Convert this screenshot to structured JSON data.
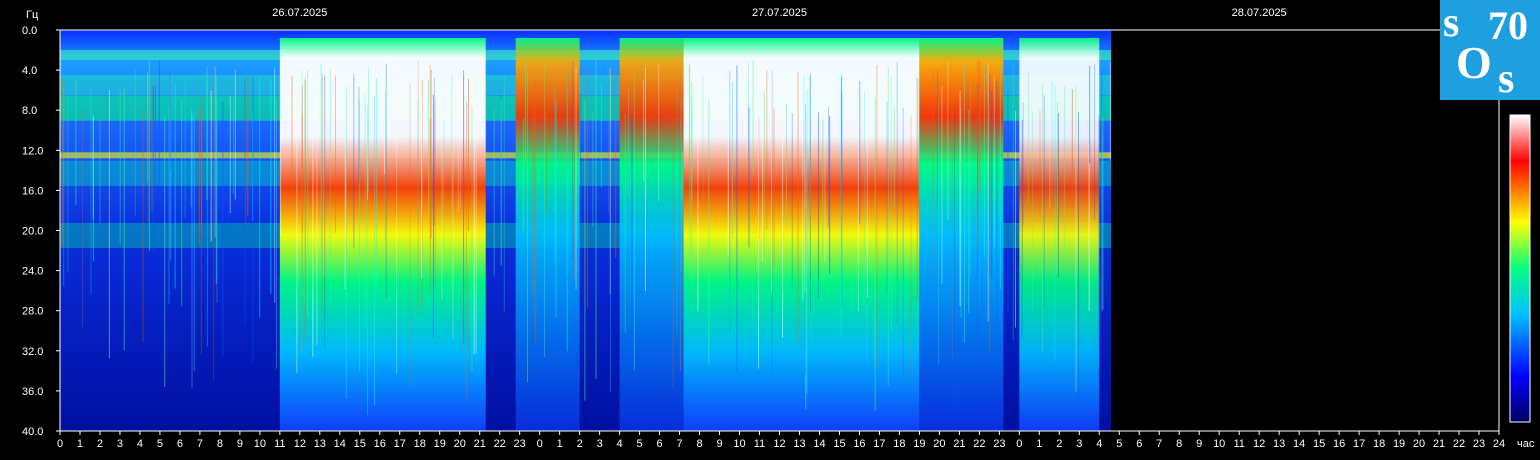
{
  "chart_data": {
    "type": "heatmap",
    "title": "",
    "ylabel": "Гц",
    "xlabel": "час",
    "ylim": [
      0,
      40
    ],
    "yticks": [
      "0.0",
      "4.0",
      "8.0",
      "12.0",
      "16.0",
      "20.0",
      "24.0",
      "28.0",
      "32.0",
      "36.0",
      "40.0"
    ],
    "xticks": [
      "0",
      "1",
      "2",
      "3",
      "4",
      "5",
      "6",
      "7",
      "8",
      "9",
      "10",
      "11",
      "12",
      "13",
      "14",
      "15",
      "16",
      "17",
      "18",
      "19",
      "20",
      "21",
      "22",
      "23",
      "0",
      "1",
      "2",
      "3",
      "4",
      "5",
      "6",
      "7",
      "8",
      "9",
      "10",
      "11",
      "12",
      "13",
      "14",
      "15",
      "16",
      "17",
      "18",
      "19",
      "20",
      "21",
      "22",
      "23",
      "0",
      "1",
      "2",
      "3",
      "4",
      "5",
      "6",
      "7",
      "8",
      "9",
      "10",
      "11",
      "12",
      "13",
      "14",
      "15",
      "16",
      "17",
      "18",
      "19",
      "20",
      "21",
      "22",
      "23",
      "24"
    ],
    "dates": [
      "26.07.2025",
      "27.07.2025",
      "28.07.2025"
    ],
    "data_end_hour": 52.6,
    "colorscale": [
      "#000080",
      "#0000ff",
      "#00c0ff",
      "#00ff80",
      "#ffff00",
      "#ff0000",
      "#ffffff"
    ]
  },
  "logo": {
    "s1": "s",
    "o": "O",
    "s2": "s",
    "num": "70"
  }
}
